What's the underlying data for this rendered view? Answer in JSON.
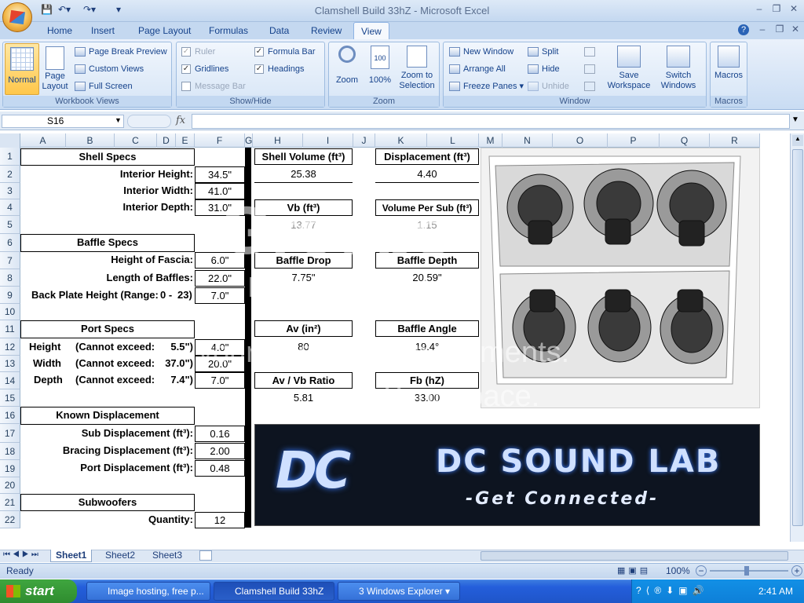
{
  "window": {
    "title": "Clamshell Build 33hZ - Microsoft Excel"
  },
  "ribbon": {
    "tabs": [
      "Home",
      "Insert",
      "Page Layout",
      "Formulas",
      "Data",
      "Review",
      "View"
    ],
    "workbook_views": {
      "label": "Workbook Views",
      "normal": "Normal",
      "page_layout": "Page Layout",
      "page_break": "Page Break Preview",
      "custom_views": "Custom Views",
      "full_screen": "Full Screen"
    },
    "show_hide": {
      "label": "Show/Hide",
      "ruler": "Ruler",
      "gridlines": "Gridlines",
      "message_bar": "Message Bar",
      "formula_bar": "Formula Bar",
      "headings": "Headings"
    },
    "zoom": {
      "label": "Zoom",
      "zoom": "Zoom",
      "pct": "100%",
      "zoom_sel": "Zoom to Selection"
    },
    "window": {
      "label": "Window",
      "new_window": "New Window",
      "arrange_all": "Arrange All",
      "freeze_panes": "Freeze Panes",
      "split": "Split",
      "hide": "Hide",
      "unhide": "Unhide",
      "save_ws": "Save Workspace",
      "switch": "Switch Windows"
    },
    "macros": {
      "label": "Macros",
      "macros": "Macros"
    }
  },
  "formula_bar": {
    "name_box": "S16",
    "fx": "fx",
    "value": ""
  },
  "columns": [
    "A",
    "B",
    "C",
    "D",
    "E",
    "F",
    "G",
    "H",
    "I",
    "J",
    "K",
    "L",
    "M",
    "N",
    "O",
    "P",
    "Q",
    "R"
  ],
  "rows": [
    "1",
    "2",
    "3",
    "4",
    "5",
    "6",
    "7",
    "8",
    "9",
    "10",
    "11",
    "12",
    "13",
    "14",
    "15",
    "16",
    "17",
    "18",
    "19",
    "20",
    "21",
    "22"
  ],
  "sheet": {
    "shell_specs": "Shell Specs",
    "interior_height": "Interior Height:",
    "interior_height_v": "34.5\"",
    "interior_width": "Interior Width:",
    "interior_width_v": "41.0\"",
    "interior_depth": "Interior Depth:",
    "interior_depth_v": "31.0\"",
    "baffle_specs": "Baffle Specs",
    "fascia": "Height of Fascia:",
    "fascia_v": "6.0\"",
    "baffle_len": "Length of Baffles:",
    "baffle_len_v": "22.0\"",
    "back_plate": "Back Plate Height (Range:",
    "back_plate_range": "0 -",
    "back_plate_max": "23)",
    "back_plate_v": "7.0\"",
    "port_specs": "Port Specs",
    "height": "Height",
    "width": "Width",
    "depth": "Depth",
    "cannot": "(Cannot exceed:",
    "height_max": "5.5\")",
    "width_max": "37.0\")",
    "depth_max": "7.4\")",
    "height_v": "4.0\"",
    "width_v": "20.0\"",
    "depth_v": "7.0\"",
    "known_disp": "Known Displacement",
    "sub_disp": "Sub Displacement (ft³):",
    "sub_disp_v": "0.16",
    "brace_disp": "Bracing Displacement (ft³):",
    "brace_disp_v": "2.00",
    "port_disp": "Port Displacement (ft³):",
    "port_disp_v": "0.48",
    "subwoofers": "Subwoofers",
    "quantity": "Quantity:",
    "quantity_v": "12",
    "shell_volume": "Shell Volume (ft³)",
    "shell_volume_v": "25.38",
    "displacement": "Displacement (ft³)",
    "displacement_v": "4.40",
    "vb": "Vb (ft³)",
    "vb_v": "13.77",
    "vol_per_sub": "Volume Per Sub (ft³)",
    "vol_per_sub_v": "1.15",
    "baffle_drop": "Baffle Drop",
    "baffle_drop_v": "7.75\"",
    "baffle_depth": "Baffle Depth",
    "baffle_depth_v": "20.59\"",
    "av": "Av (in²)",
    "av_v": "80",
    "baffle_angle": "Baffle Angle",
    "baffle_angle_v": "19.4°",
    "ratio": "Av / Vb Ratio",
    "ratio_v": "5.81",
    "fb": "Fb (hZ)",
    "fb_v": "33.00"
  },
  "watermark": {
    "logo": "Groups",
    "line1": "by photobucket",
    "line2": "your people. Your moments.",
    "line3": "Your space."
  },
  "banner": {
    "logo": "DC",
    "title": "DC SOUND LAB",
    "tagline": "-Get Connected-"
  },
  "sheets": [
    "Sheet1",
    "Sheet2",
    "Sheet3"
  ],
  "status": {
    "ready": "Ready",
    "zoom": "100%"
  },
  "taskbar": {
    "start": "start",
    "tasks": [
      "Image hosting, free p...",
      "Clamshell Build 33hZ",
      "3 Windows Explorer"
    ],
    "clock": "2:41 AM"
  }
}
